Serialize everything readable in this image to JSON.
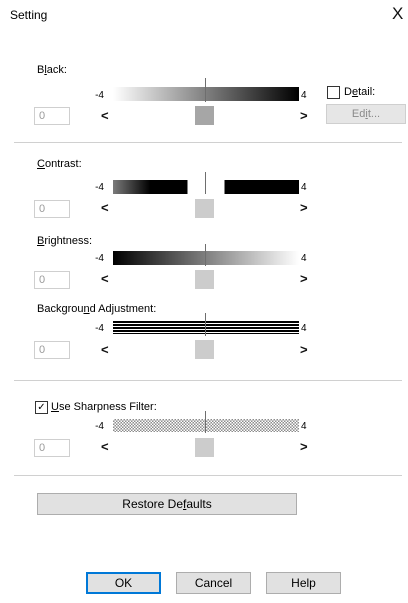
{
  "window": {
    "title": "Setting",
    "close_glyph": "X"
  },
  "sliders": {
    "black": {
      "label_pre": "B",
      "label_acc": "l",
      "label_post": "ack:",
      "min_label": "-4",
      "max_label": "4",
      "value": "0",
      "level": 0
    },
    "contrast": {
      "label_pre": "",
      "label_acc": "C",
      "label_post": "ontrast:",
      "min_label": "-4",
      "max_label": "4",
      "value": "0",
      "level": 0
    },
    "brightness": {
      "label_pre": "",
      "label_acc": "B",
      "label_post": "rightness:",
      "min_label": "-4",
      "max_label": "4",
      "value": "0",
      "level": 0
    },
    "background": {
      "label_pre": "Backgrou",
      "label_acc": "n",
      "label_post": "d Adjustment:",
      "min_label": "-4",
      "max_label": "4",
      "value": "0",
      "level": 0
    },
    "sharpness": {
      "min_label": "-4",
      "max_label": "4",
      "value": "0",
      "level": 0
    }
  },
  "detail": {
    "label_pre": "D",
    "label_acc": "e",
    "label_post": "tail:",
    "checked": false,
    "edit_pre": "Ed",
    "edit_acc": "i",
    "edit_post": "t..."
  },
  "sharpness_filter": {
    "label_pre": "",
    "label_acc": "U",
    "label_post": "se Sharpness Filter:",
    "checked": true,
    "check_glyph": "✓"
  },
  "arrows": {
    "left": "<",
    "right": ">"
  },
  "buttons": {
    "restore_pre": "Restore De",
    "restore_acc": "f",
    "restore_post": "aults",
    "ok": "OK",
    "cancel": "Cancel",
    "help": "Help"
  },
  "colors": {
    "accent": "#0078d7",
    "button_bg": "#e1e1e1",
    "thumb_active": "#a6a6a6",
    "thumb": "#cccccc"
  }
}
